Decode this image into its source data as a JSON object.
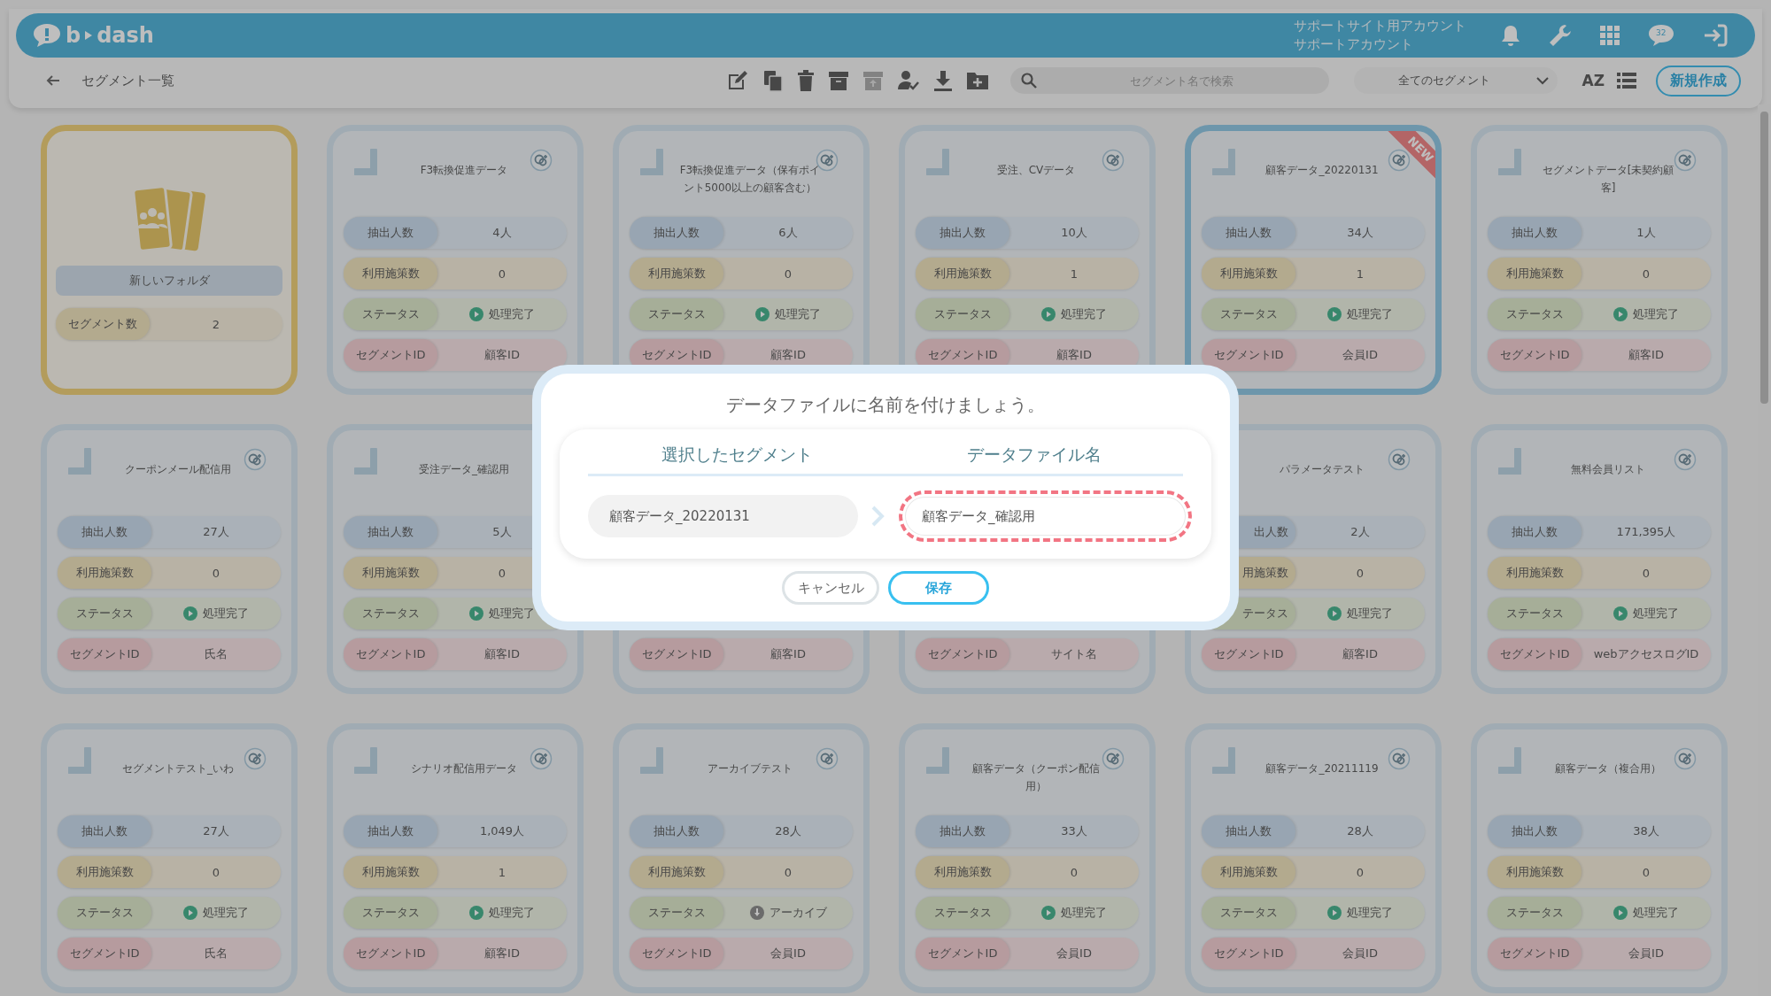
{
  "header": {
    "logo": [
      "b",
      "dash"
    ],
    "account": [
      "サポートサイト用アカウント",
      "サポートアカウント"
    ],
    "chat_badge": "32"
  },
  "toolbar": {
    "title": "セグメント一覧",
    "search": {
      "placeholder": "セグメント名で検索"
    },
    "filter": "全てのセグメント",
    "sort_label": "AZ",
    "new_button": "新規作成"
  },
  "cards": [
    {
      "kind": "folder",
      "title": "新しいフォルダ",
      "rows": [
        {
          "kind": "usage",
          "label": "セグメント数",
          "value": "2"
        }
      ]
    },
    {
      "kind": "segment",
      "title": "F3転換促進データ",
      "selected": false,
      "is_new": false,
      "corner_mark": true,
      "gear_icon": true,
      "rows": [
        {
          "kind": "count",
          "label": "抽出人数",
          "value": "4人"
        },
        {
          "kind": "usage",
          "label": "利用施策数",
          "value": "0"
        },
        {
          "kind": "status",
          "label": "ステータス",
          "value": "処理完了",
          "archived": false
        },
        {
          "kind": "id",
          "label": "セグメントID",
          "value": "顧客ID"
        }
      ]
    },
    {
      "kind": "segment",
      "title": "F3転換促進データ（保有ポイント5000以上の顧客含む）",
      "selected": false,
      "is_new": false,
      "corner_mark": true,
      "gear_icon": true,
      "rows": [
        {
          "kind": "count",
          "label": "抽出人数",
          "value": "6人"
        },
        {
          "kind": "usage",
          "label": "利用施策数",
          "value": "0"
        },
        {
          "kind": "status",
          "label": "ステータス",
          "value": "処理完了",
          "archived": false
        },
        {
          "kind": "id",
          "label": "セグメントID",
          "value": "顧客ID"
        }
      ]
    },
    {
      "kind": "segment",
      "title": "受注、CVデータ",
      "selected": false,
      "is_new": false,
      "corner_mark": true,
      "gear_icon": true,
      "rows": [
        {
          "kind": "count",
          "label": "抽出人数",
          "value": "10人"
        },
        {
          "kind": "usage",
          "label": "利用施策数",
          "value": "1"
        },
        {
          "kind": "status",
          "label": "ステータス",
          "value": "処理完了",
          "archived": false
        },
        {
          "kind": "id",
          "label": "セグメントID",
          "value": "顧客ID"
        }
      ]
    },
    {
      "kind": "segment",
      "title": "顧客データ_20220131",
      "selected": true,
      "is_new": true,
      "new_label": "NEW",
      "corner_mark": true,
      "gear_icon": true,
      "rows": [
        {
          "kind": "count",
          "label": "抽出人数",
          "value": "34人"
        },
        {
          "kind": "usage",
          "label": "利用施策数",
          "value": "1"
        },
        {
          "kind": "status",
          "label": "ステータス",
          "value": "処理完了",
          "archived": false
        },
        {
          "kind": "id",
          "label": "セグメントID",
          "value": "会員ID"
        }
      ]
    },
    {
      "kind": "segment",
      "title": "セグメントデータ[未契約顧客]",
      "selected": false,
      "is_new": false,
      "corner_mark": true,
      "gear_icon": true,
      "rows": [
        {
          "kind": "count",
          "label": "抽出人数",
          "value": "1人"
        },
        {
          "kind": "usage",
          "label": "利用施策数",
          "value": "0"
        },
        {
          "kind": "status",
          "label": "ステータス",
          "value": "処理完了",
          "archived": false
        },
        {
          "kind": "id",
          "label": "セグメントID",
          "value": "顧客ID"
        }
      ]
    },
    {
      "kind": "segment",
      "title": "クーポンメール配信用",
      "selected": false,
      "is_new": false,
      "corner_mark": true,
      "gear_icon": true,
      "rows": [
        {
          "kind": "count",
          "label": "抽出人数",
          "value": "27人"
        },
        {
          "kind": "usage",
          "label": "利用施策数",
          "value": "0"
        },
        {
          "kind": "status",
          "label": "ステータス",
          "value": "処理完了",
          "archived": false
        },
        {
          "kind": "id",
          "label": "セグメントID",
          "value": "氏名"
        }
      ]
    },
    {
      "kind": "segment",
      "title": "受注データ_確認用",
      "selected": false,
      "corner_mark": true,
      "rows": [
        {
          "kind": "count",
          "label": "抽出人数",
          "value": "5人"
        },
        {
          "kind": "usage",
          "label": "利用施策数",
          "value": "0"
        },
        {
          "kind": "status",
          "label": "ステータス",
          "value": "処理完了",
          "archived": false
        },
        {
          "kind": "id",
          "label": "セグメントID",
          "value": "顧客ID"
        }
      ]
    },
    {
      "kind": "segment",
      "selected": false,
      "rows": [
        {
          "kind": "id",
          "label": "セグメントID",
          "value": "顧客ID"
        }
      ]
    },
    {
      "kind": "segment",
      "selected": false,
      "rows": [
        {
          "kind": "id",
          "label": "セグメントID",
          "value": "サイト名"
        }
      ]
    },
    {
      "kind": "segment",
      "title": "パラメータテスト",
      "selected": false,
      "is_new": false,
      "gear_icon": true,
      "rows": [
        {
          "kind": "count",
          "label": "出人数",
          "label_partial": true,
          "value": "2人"
        },
        {
          "kind": "usage",
          "label": "用施策数",
          "label_partial": true,
          "value": "0"
        },
        {
          "kind": "status",
          "label": "テータス",
          "label_partial": true,
          "value": "処理完了",
          "archived": false
        },
        {
          "kind": "id",
          "label": "セグメントID",
          "value": "顧客ID"
        }
      ]
    },
    {
      "kind": "segment",
      "title": "無料会員リスト",
      "selected": false,
      "is_new": false,
      "corner_mark": true,
      "gear_icon": true,
      "rows": [
        {
          "kind": "count",
          "label": "抽出人数",
          "value": "171,395人"
        },
        {
          "kind": "usage",
          "label": "利用施策数",
          "value": "0"
        },
        {
          "kind": "status",
          "label": "ステータス",
          "value": "処理完了",
          "archived": false
        },
        {
          "kind": "id",
          "label": "セグメントID",
          "value": "webアクセスログID"
        }
      ]
    },
    {
      "kind": "segment",
      "title": "セグメントテスト_いわ",
      "selected": false,
      "is_new": false,
      "corner_mark": true,
      "gear_icon": true,
      "rows": [
        {
          "kind": "count",
          "label": "抽出人数",
          "value": "27人"
        },
        {
          "kind": "usage",
          "label": "利用施策数",
          "value": "0"
        },
        {
          "kind": "status",
          "label": "ステータス",
          "value": "処理完了",
          "archived": false
        },
        {
          "kind": "id",
          "label": "セグメントID",
          "value": "氏名"
        }
      ]
    },
    {
      "kind": "segment",
      "title": "シナリオ配信用データ",
      "selected": false,
      "is_new": false,
      "corner_mark": true,
      "gear_icon": true,
      "rows": [
        {
          "kind": "count",
          "label": "抽出人数",
          "value": "1,049人"
        },
        {
          "kind": "usage",
          "label": "利用施策数",
          "value": "1"
        },
        {
          "kind": "status",
          "label": "ステータス",
          "value": "処理完了",
          "archived": false
        },
        {
          "kind": "id",
          "label": "セグメントID",
          "value": "顧客ID"
        }
      ]
    },
    {
      "kind": "segment",
      "title": "アーカイブテスト",
      "selected": false,
      "is_new": false,
      "corner_mark": true,
      "gear_icon": true,
      "rows": [
        {
          "kind": "count",
          "label": "抽出人数",
          "value": "28人"
        },
        {
          "kind": "usage",
          "label": "利用施策数",
          "value": "0"
        },
        {
          "kind": "status",
          "label": "ステータス",
          "value": "アーカイブ",
          "archived": true
        },
        {
          "kind": "id",
          "label": "セグメントID",
          "value": "会員ID"
        }
      ]
    },
    {
      "kind": "segment",
      "title": "顧客データ（クーポン配信用）",
      "selected": false,
      "is_new": false,
      "corner_mark": true,
      "gear_icon": true,
      "rows": [
        {
          "kind": "count",
          "label": "抽出人数",
          "value": "33人"
        },
        {
          "kind": "usage",
          "label": "利用施策数",
          "value": "0"
        },
        {
          "kind": "status",
          "label": "ステータス",
          "value": "処理完了",
          "archived": false
        },
        {
          "kind": "id",
          "label": "セグメントID",
          "value": "会員ID"
        }
      ]
    },
    {
      "kind": "segment",
      "title": "顧客データ_20211119",
      "selected": false,
      "is_new": false,
      "corner_mark": true,
      "gear_icon": true,
      "rows": [
        {
          "kind": "count",
          "label": "抽出人数",
          "value": "28人"
        },
        {
          "kind": "usage",
          "label": "利用施策数",
          "value": "0"
        },
        {
          "kind": "status",
          "label": "ステータス",
          "value": "処理完了",
          "archived": false
        },
        {
          "kind": "id",
          "label": "セグメントID",
          "value": "会員ID"
        }
      ]
    },
    {
      "kind": "segment",
      "title": "顧客データ（複合用）",
      "selected": false,
      "is_new": false,
      "corner_mark": true,
      "gear_icon": true,
      "rows": [
        {
          "kind": "count",
          "label": "抽出人数",
          "value": "38人"
        },
        {
          "kind": "usage",
          "label": "利用施策数",
          "value": "0"
        },
        {
          "kind": "status",
          "label": "ステータス",
          "value": "処理完了",
          "archived": false
        },
        {
          "kind": "id",
          "label": "セグメントID",
          "value": "会員ID"
        }
      ]
    }
  ],
  "dialog": {
    "title": "データファイルに名前を付けましょう。",
    "columns": [
      "選択したセグメント",
      "データファイル名"
    ],
    "selected_segment": "顧客データ_20220131",
    "file_name": {
      "value": "顧客データ_確認用",
      "highlighted": true
    },
    "buttons": [
      {
        "kind": "cancel",
        "label": "キャンセル"
      },
      {
        "kind": "save",
        "label": "保存"
      }
    ]
  }
}
